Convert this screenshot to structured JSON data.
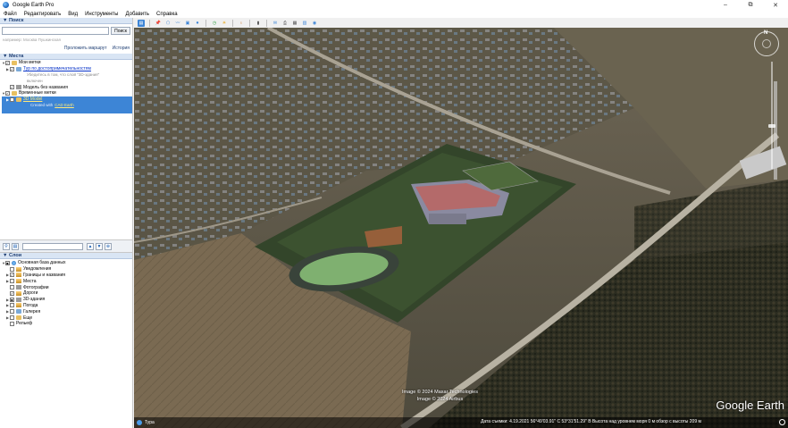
{
  "window": {
    "title": "Google Earth Pro",
    "min_label": "–",
    "max_label": "⧉",
    "close_label": "✕"
  },
  "menu": [
    "Файл",
    "Редактировать",
    "Вид",
    "Инструменты",
    "Добавить",
    "Справка"
  ],
  "search": {
    "header": "▼ Поиск",
    "button": "Поиск",
    "hint": "например: Москва Пушкинская",
    "route_link": "Проложить маршрут",
    "history_link": "История"
  },
  "places": {
    "header": "▼ Места",
    "rows": [
      {
        "label": "Мои метки",
        "sub": ""
      },
      {
        "label": "Тур по достопримечательностям",
        "sub": ""
      },
      {
        "label": "",
        "sub": "Убедитесь в том, что слой \"3D-здания\""
      },
      {
        "label": "",
        "sub": "включен"
      },
      {
        "label": "Модель без названия",
        "sub": ""
      },
      {
        "label": "Временные метки",
        "sub": ""
      },
      {
        "label": "3D Model",
        "sub": ""
      },
      {
        "label": "",
        "sub": "Created with",
        "link": "CAD Earth"
      }
    ]
  },
  "layers": {
    "header": "▼ Слои",
    "rows": [
      {
        "label": "Основная база данных"
      },
      {
        "label": "Уведомления"
      },
      {
        "label": "Границы и названия"
      },
      {
        "label": "Места"
      },
      {
        "label": "Фотографии"
      },
      {
        "label": "Дороги"
      },
      {
        "label": "3D-здания"
      },
      {
        "label": "Погода"
      },
      {
        "label": "Галерея"
      },
      {
        "label": "Еще"
      },
      {
        "label": "Рельеф"
      }
    ]
  },
  "map": {
    "nav_north": "N",
    "watermark": "Google Earth",
    "copyright_line1": "Image © 2024 Maxar Technologies",
    "copyright_line2": "Image © 2024 Airbus",
    "tour_label": "Тура",
    "status": "Дата съемки: 4.19.2021   56°49'03.91\" С   53°31'51.29\" В   Высота над уровнем моря   0 м   обзор с высоты   209 м"
  },
  "colors": {
    "selection": "#3d85d6",
    "panel_header": "#d9e5f4",
    "link": "#0a35c9"
  }
}
